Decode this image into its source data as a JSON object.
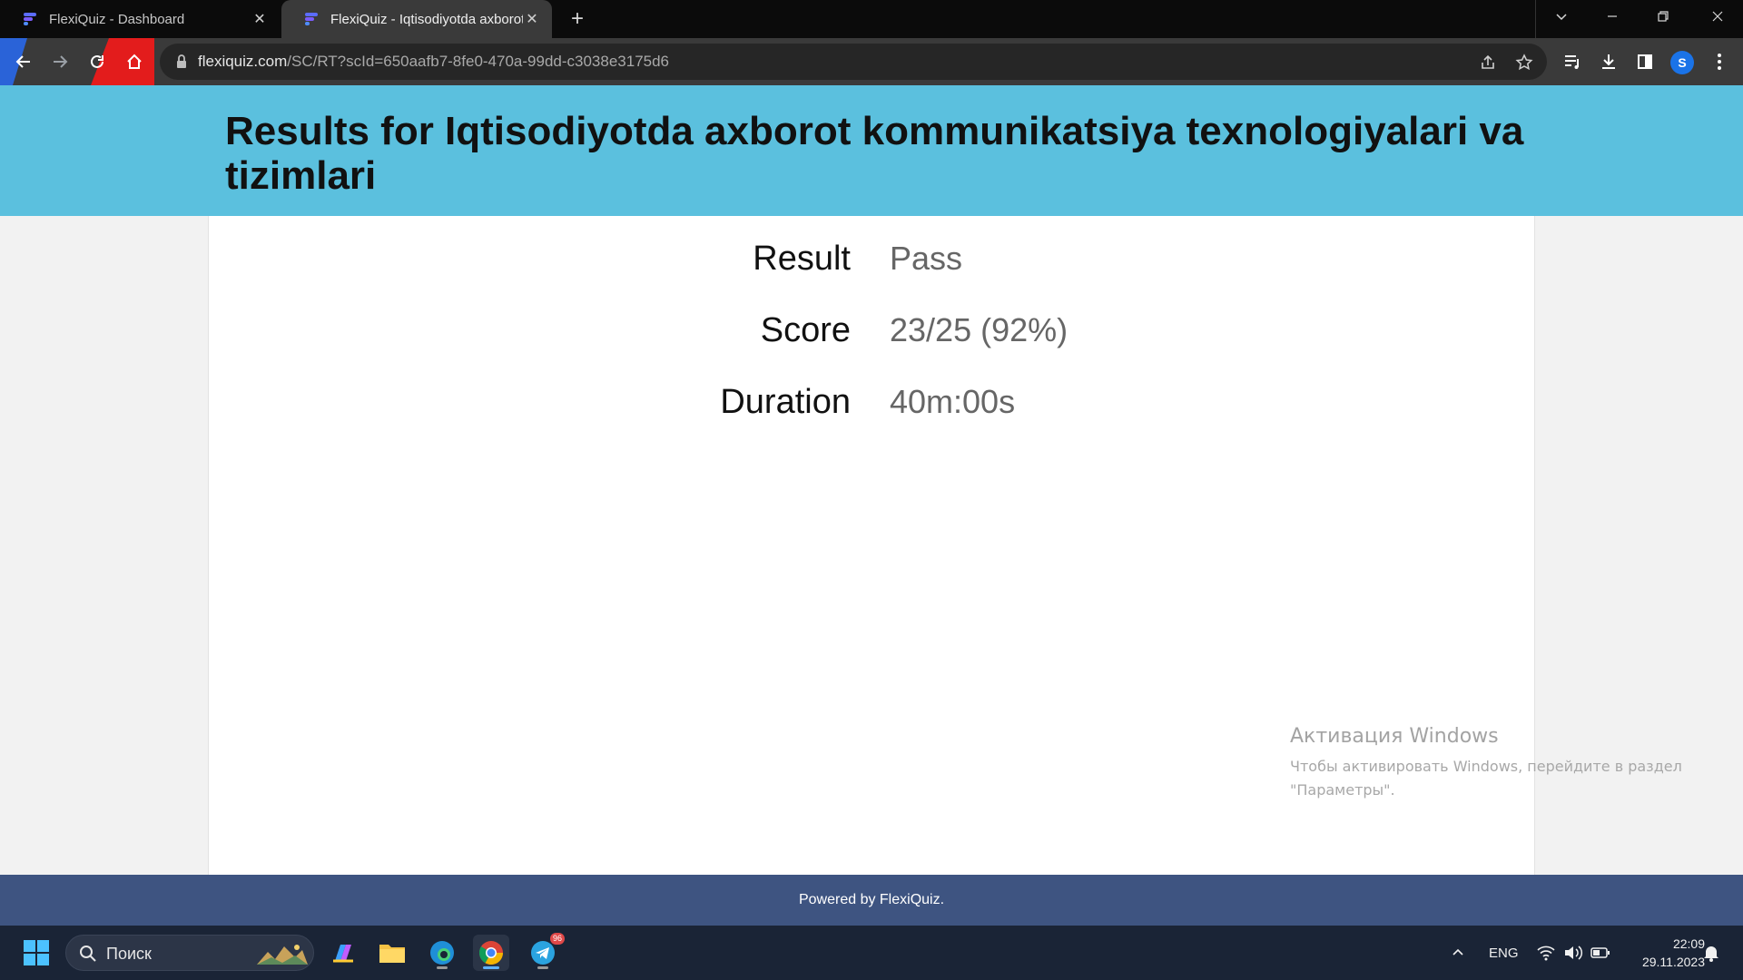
{
  "browser": {
    "tabs": [
      {
        "title": "FlexiQuiz - Dashboard",
        "active": false
      },
      {
        "title": "FlexiQuiz - Iqtisodiyotda axborot",
        "active": true
      }
    ],
    "url_host": "flexiquiz.com",
    "url_path": "/SC/RT?scId=650aafb7-8fe0-470a-99dd-c3038e3175d6",
    "profile_initial": "S"
  },
  "page": {
    "title": "Results for Iqtisodiyotda axborot kommunikatsiya texnologiyalari va tizimlari",
    "results": [
      {
        "label": "Result",
        "value": "Pass"
      },
      {
        "label": "Score",
        "value": "23/25 (92%)"
      },
      {
        "label": "Duration",
        "value": "40m:00s"
      }
    ],
    "footer": "Powered by FlexiQuiz."
  },
  "watermark": {
    "title": "Активация Windows",
    "line1": "Чтобы активировать Windows, перейдите в раздел",
    "line2": "\"Параметры\"."
  },
  "taskbar": {
    "search_label": "Поиск",
    "telegram_badge": "96",
    "language": "ENG",
    "time": "22:09",
    "date": "29.11.2023"
  },
  "colors": {
    "header_bg": "#5bc0de",
    "footer_bg": "#3e5481",
    "value_text": "#666666"
  }
}
